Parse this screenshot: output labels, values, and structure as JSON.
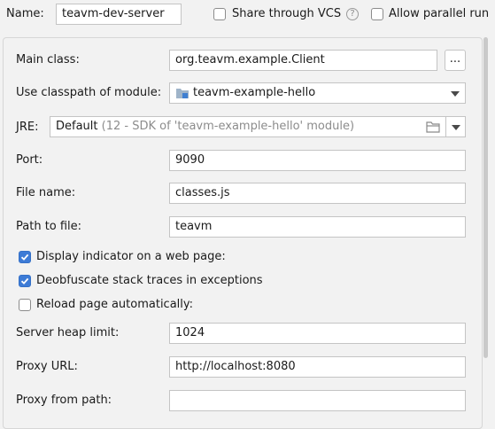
{
  "header": {
    "name_label": "Name:",
    "name_value": "teavm-dev-server",
    "share_vcs_label": "Share through VCS",
    "share_vcs_checked": false,
    "help_glyph": "?",
    "allow_parallel_label": "Allow parallel run",
    "allow_parallel_checked": false
  },
  "form": {
    "main_class": {
      "label": "Main class:",
      "value": "org.teavm.example.Client",
      "browse_label": "..."
    },
    "classpath": {
      "label": "Use classpath of module:",
      "value": "teavm-example-hello",
      "icon": "module-folder-icon"
    },
    "jre": {
      "label": "JRE:",
      "value": "Default",
      "detail": "(12 - SDK of 'teavm-example-hello' module)",
      "icon": "folder-icon"
    },
    "port": {
      "label": "Port:",
      "value": "9090"
    },
    "file_name": {
      "label": "File name:",
      "value": "classes.js"
    },
    "path_to_file": {
      "label": "Path to file:",
      "value": "teavm"
    },
    "display_indicator": {
      "label": "Display indicator on a web page:",
      "checked": true
    },
    "deobfuscate": {
      "label": "Deobfuscate stack traces in exceptions",
      "checked": true
    },
    "reload_page": {
      "label": "Reload page automatically:",
      "checked": false
    },
    "heap_limit": {
      "label": "Server heap limit:",
      "value": "1024"
    },
    "proxy_url": {
      "label": "Proxy URL:",
      "value": "http://localhost:8080"
    },
    "proxy_from_path": {
      "label": "Proxy from path:",
      "value": ""
    }
  },
  "colors": {
    "background": "#f2f2f2",
    "field_border": "#c4c4c4",
    "checkbox_on": "#3d7bd6"
  }
}
